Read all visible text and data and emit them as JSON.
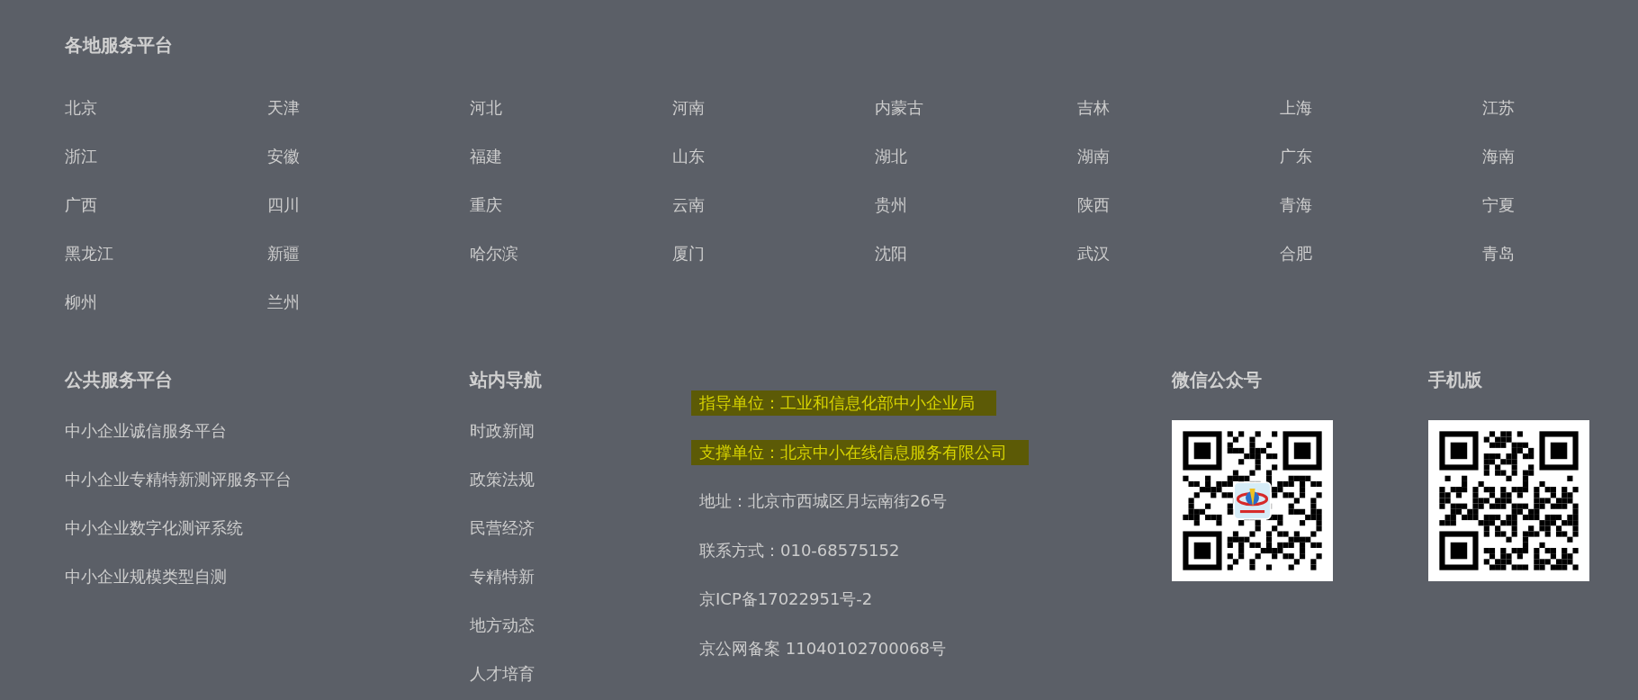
{
  "regional": {
    "title": "各地服务平台",
    "cities": [
      "北京",
      "天津",
      "河北",
      "河南",
      "内蒙古",
      "吉林",
      "上海",
      "江苏",
      "浙江",
      "安徽",
      "福建",
      "山东",
      "湖北",
      "湖南",
      "广东",
      "海南",
      "广西",
      "四川",
      "重庆",
      "云南",
      "贵州",
      "陕西",
      "青海",
      "宁夏",
      "黑龙江",
      "新疆",
      "哈尔滨",
      "厦门",
      "沈阳",
      "武汉",
      "合肥",
      "青岛",
      "柳州",
      "兰州"
    ]
  },
  "public_services": {
    "title": "公共服务平台",
    "links": [
      "中小企业诚信服务平台",
      "中小企业专精特新测评服务平台",
      "中小企业数字化测评系统",
      "中小企业规模类型自测"
    ]
  },
  "site_nav": {
    "title": "站内导航",
    "links": [
      "时政新闻",
      "政策法规",
      "民营经济",
      "专精特新",
      "地方动态",
      "人才培育"
    ]
  },
  "info": [
    {
      "text": "指导单位：工业和信息化部中小企业局",
      "highlighted": true
    },
    {
      "text": "支撑单位：北京中小在线信息服务有限公司",
      "highlighted": true
    },
    {
      "text": "地址：北京市西城区月坛南街26号",
      "highlighted": false
    },
    {
      "text": "联系方式：010-68575152",
      "highlighted": false
    },
    {
      "text": "京ICP备17022951号-2",
      "highlighted": false
    },
    {
      "text": "京公网备案 11040102700068号",
      "highlighted": false
    }
  ],
  "qr_codes": [
    {
      "title": "微信公众号",
      "center_logo": true
    },
    {
      "title": "手机版",
      "center_logo": false
    }
  ]
}
